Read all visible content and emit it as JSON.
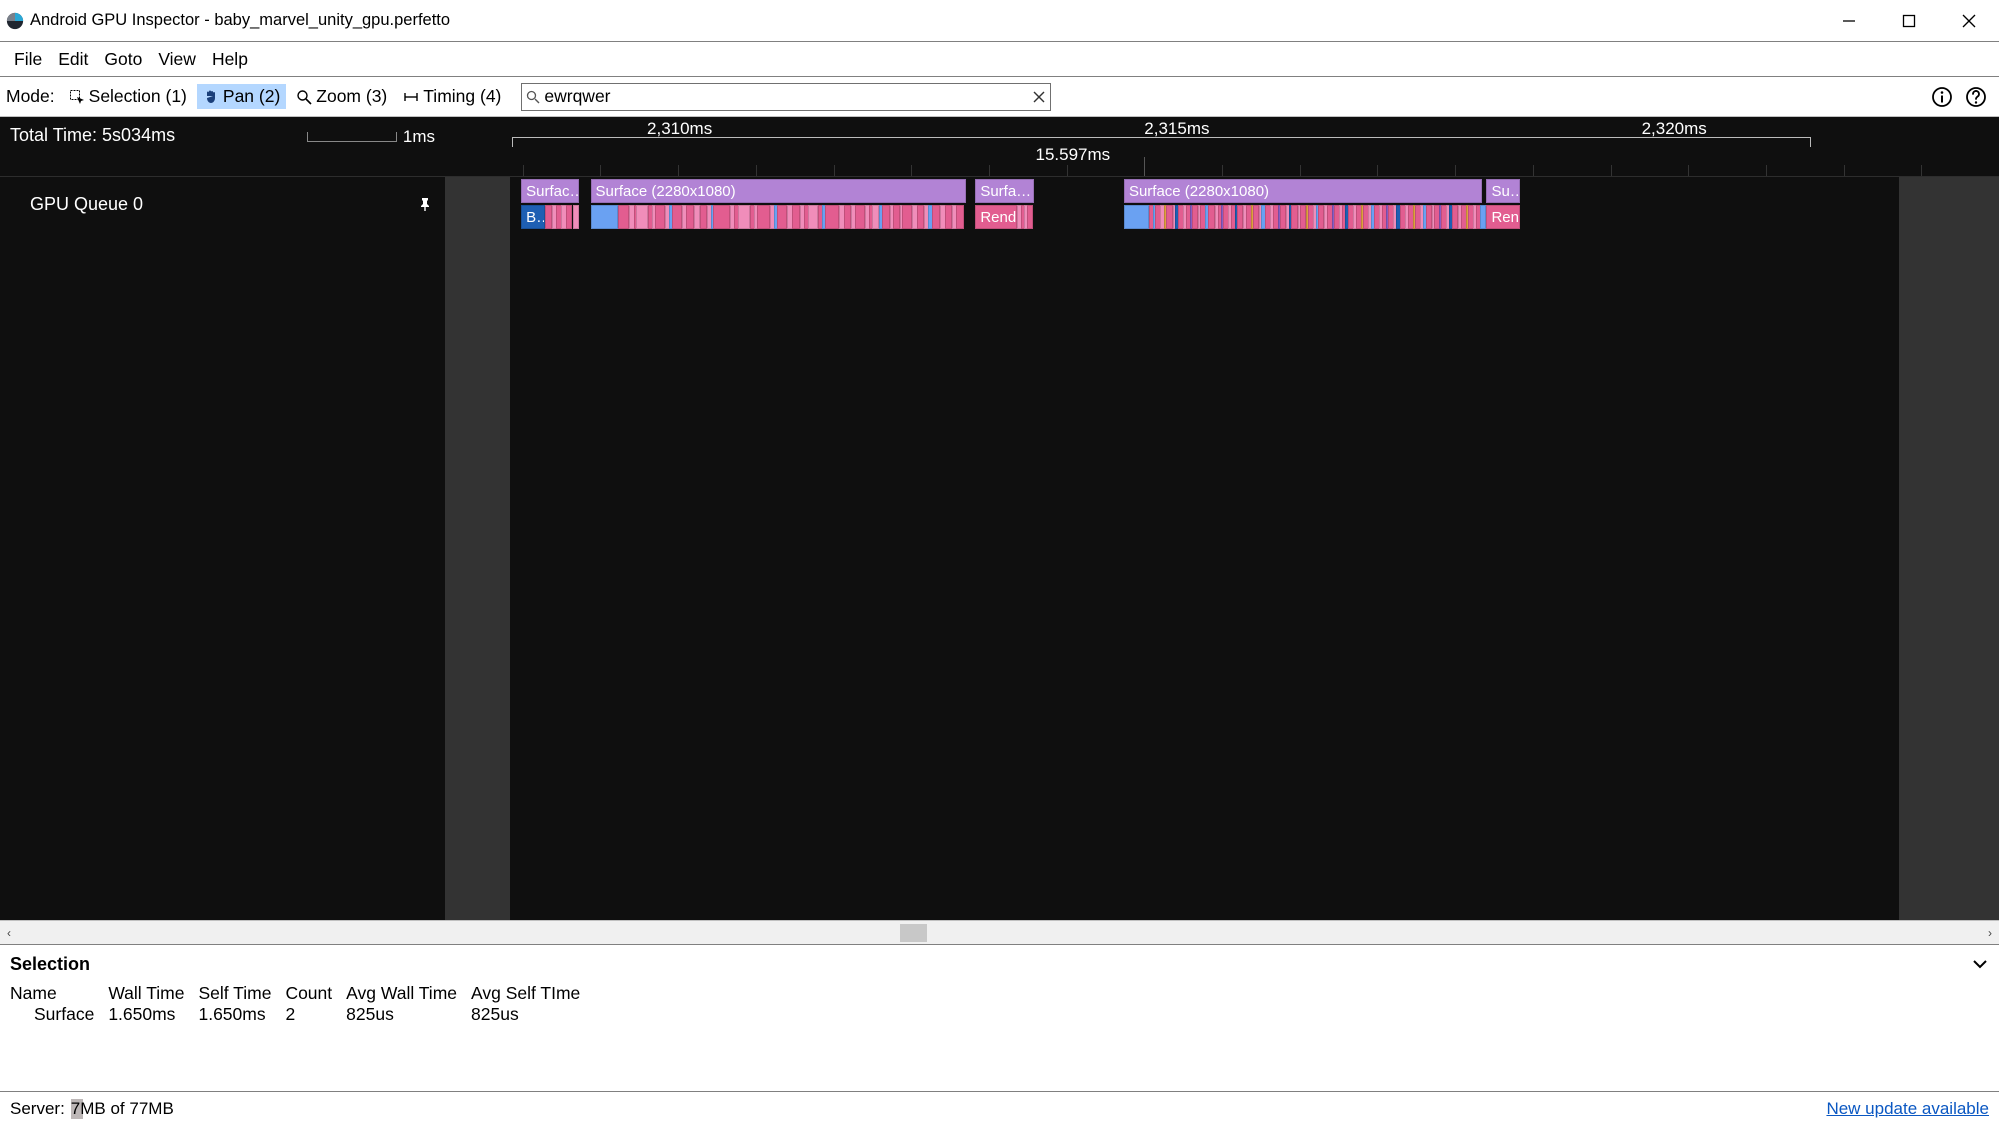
{
  "window": {
    "title": "Android GPU Inspector - baby_marvel_unity_gpu.perfetto"
  },
  "menubar": {
    "items": [
      "File",
      "Edit",
      "Goto",
      "View",
      "Help"
    ]
  },
  "toolbar": {
    "mode_label": "Mode:",
    "tools": {
      "selection": "Selection (1)",
      "pan": "Pan (2)",
      "zoom": "Zoom (3)",
      "timing": "Timing (4)"
    },
    "search_value": "ewrqwer"
  },
  "trace": {
    "total_time_label": "Total Time: 5s034ms",
    "scale_label": "1ms",
    "ruler_ticks": [
      "2,310ms",
      "2,315ms",
      "2,320ms"
    ],
    "range_label": "15.597ms",
    "track_name": "GPU Queue 0",
    "slices_row0": [
      {
        "label": "Surfac…",
        "l": 0.8,
        "w": 4.2,
        "cls": "purple"
      },
      {
        "label": "Surface (2280x1080)",
        "l": 5.8,
        "w": 27.0,
        "cls": "purple"
      },
      {
        "label": "Surfa…",
        "l": 33.5,
        "w": 4.2,
        "cls": "purple"
      },
      {
        "label": "Surface (2280x1080)",
        "l": 44.2,
        "w": 25.8,
        "cls": "purple"
      },
      {
        "label": "Su…",
        "l": 70.3,
        "w": 2.4,
        "cls": "purple"
      }
    ],
    "slices_row0_gaps": [
      {
        "l": 5.0,
        "w": 0.23
      },
      {
        "l": 5.25,
        "w": 0.18
      },
      {
        "l": 5.45,
        "w": 0.15
      },
      {
        "l": 37.9,
        "w": 0.12
      },
      {
        "l": 38.2,
        "w": 0.23
      },
      {
        "l": 38.5,
        "w": 0.14
      },
      {
        "l": 38.8,
        "w": 0.35
      },
      {
        "l": 39.2,
        "w": 0.1
      },
      {
        "l": 39.4,
        "w": 0.2
      },
      {
        "l": 39.7,
        "w": 0.18
      },
      {
        "l": 40.0,
        "w": 0.4
      },
      {
        "l": 40.6,
        "w": 0.12
      },
      {
        "l": 40.9,
        "w": 0.5
      },
      {
        "l": 41.6,
        "w": 0.1
      },
      {
        "l": 41.9,
        "w": 0.35
      },
      {
        "l": 42.4,
        "w": 0.1
      },
      {
        "l": 42.7,
        "w": 0.35
      },
      {
        "l": 43.2,
        "w": 0.18
      },
      {
        "l": 43.5,
        "w": 0.35
      },
      {
        "l": 43.9,
        "w": 0.1
      }
    ],
    "slices_row1": [
      {
        "label": "B…",
        "l": 0.8,
        "w": 1.7,
        "cls": "blue-dark"
      },
      {
        "label": "",
        "l": 2.5,
        "w": 0.5,
        "cls": "pink"
      },
      {
        "label": "",
        "l": 3.0,
        "w": 0.3,
        "cls": "pink-light"
      },
      {
        "label": "",
        "l": 3.3,
        "w": 0.4,
        "cls": "pink"
      },
      {
        "label": "",
        "l": 3.7,
        "w": 0.3,
        "cls": "pink-light"
      },
      {
        "label": "",
        "l": 4.0,
        "w": 0.5,
        "cls": "pink"
      },
      {
        "label": "",
        "l": 4.5,
        "w": 0.4,
        "cls": "pink-light"
      },
      {
        "label": "",
        "l": 5.8,
        "w": 2.0,
        "cls": "blue-mid"
      },
      {
        "label": "",
        "l": 7.8,
        "w": 0.8,
        "cls": "pink"
      },
      {
        "label": "",
        "l": 8.6,
        "w": 0.3,
        "cls": "pink-light"
      },
      {
        "label": "",
        "l": 8.9,
        "w": 0.2,
        "cls": "pink"
      },
      {
        "label": "",
        "l": 9.1,
        "w": 0.8,
        "cls": "pink-light"
      },
      {
        "label": "",
        "l": 9.9,
        "w": 0.3,
        "cls": "pink"
      },
      {
        "label": "",
        "l": 10.2,
        "w": 0.25,
        "cls": "pink-light"
      },
      {
        "label": "",
        "l": 10.45,
        "w": 0.7,
        "cls": "pink"
      },
      {
        "label": "",
        "l": 11.15,
        "w": 0.3,
        "cls": "pink-light"
      },
      {
        "label": "",
        "l": 11.45,
        "w": 0.2,
        "cls": "blue-mid"
      },
      {
        "label": "",
        "l": 11.65,
        "w": 0.7,
        "cls": "pink"
      },
      {
        "label": "",
        "l": 12.35,
        "w": 0.3,
        "cls": "pink-light"
      },
      {
        "label": "",
        "l": 12.65,
        "w": 0.6,
        "cls": "pink"
      },
      {
        "label": "",
        "l": 13.25,
        "w": 0.4,
        "cls": "pink-light"
      },
      {
        "label": "",
        "l": 13.65,
        "w": 0.5,
        "cls": "pink"
      },
      {
        "label": "",
        "l": 14.15,
        "w": 0.3,
        "cls": "pink-light"
      },
      {
        "label": "",
        "l": 14.45,
        "w": 0.2,
        "cls": "blue-mid"
      },
      {
        "label": "",
        "l": 14.65,
        "w": 1.2,
        "cls": "pink"
      },
      {
        "label": "",
        "l": 15.85,
        "w": 0.3,
        "cls": "pink-light"
      },
      {
        "label": "",
        "l": 16.15,
        "w": 0.25,
        "cls": "pink"
      },
      {
        "label": "",
        "l": 16.4,
        "w": 0.9,
        "cls": "pink-light"
      },
      {
        "label": "",
        "l": 17.3,
        "w": 0.3,
        "cls": "pink"
      },
      {
        "label": "",
        "l": 17.6,
        "w": 0.2,
        "cls": "pink-light"
      },
      {
        "label": "",
        "l": 17.8,
        "w": 0.9,
        "cls": "pink"
      },
      {
        "label": "",
        "l": 18.7,
        "w": 0.3,
        "cls": "pink-light"
      },
      {
        "label": "",
        "l": 19.0,
        "w": 0.25,
        "cls": "blue-mid"
      },
      {
        "label": "",
        "l": 19.25,
        "w": 0.7,
        "cls": "pink"
      },
      {
        "label": "",
        "l": 19.95,
        "w": 0.35,
        "cls": "pink-light"
      },
      {
        "label": "",
        "l": 20.3,
        "w": 0.6,
        "cls": "pink"
      },
      {
        "label": "",
        "l": 20.9,
        "w": 0.3,
        "cls": "pink-light"
      },
      {
        "label": "",
        "l": 21.2,
        "w": 0.25,
        "cls": "pink"
      },
      {
        "label": "",
        "l": 21.45,
        "w": 0.7,
        "cls": "pink-light"
      },
      {
        "label": "",
        "l": 22.15,
        "w": 0.3,
        "cls": "pink"
      },
      {
        "label": "",
        "l": 22.45,
        "w": 0.25,
        "cls": "blue-mid"
      },
      {
        "label": "",
        "l": 22.7,
        "w": 1.0,
        "cls": "pink"
      },
      {
        "label": "",
        "l": 23.7,
        "w": 0.35,
        "cls": "pink-light"
      },
      {
        "label": "",
        "l": 24.05,
        "w": 0.5,
        "cls": "pink"
      },
      {
        "label": "",
        "l": 24.55,
        "w": 0.3,
        "cls": "pink-light"
      },
      {
        "label": "",
        "l": 24.85,
        "w": 0.7,
        "cls": "pink"
      },
      {
        "label": "",
        "l": 25.55,
        "w": 0.3,
        "cls": "pink-light"
      },
      {
        "label": "",
        "l": 25.85,
        "w": 0.2,
        "cls": "pink"
      },
      {
        "label": "",
        "l": 26.05,
        "w": 0.5,
        "cls": "pink-light"
      },
      {
        "label": "",
        "l": 26.55,
        "w": 0.2,
        "cls": "blue-mid"
      },
      {
        "label": "",
        "l": 26.75,
        "w": 0.6,
        "cls": "pink"
      },
      {
        "label": "",
        "l": 27.35,
        "w": 0.2,
        "cls": "pink-light"
      },
      {
        "label": "",
        "l": 27.55,
        "w": 0.5,
        "cls": "pink"
      },
      {
        "label": "",
        "l": 28.05,
        "w": 0.2,
        "cls": "pink-light"
      },
      {
        "label": "",
        "l": 28.25,
        "w": 0.7,
        "cls": "pink"
      },
      {
        "label": "",
        "l": 28.95,
        "w": 0.35,
        "cls": "pink-light"
      },
      {
        "label": "",
        "l": 29.3,
        "w": 0.5,
        "cls": "pink"
      },
      {
        "label": "",
        "l": 29.8,
        "w": 0.3,
        "cls": "pink-light"
      },
      {
        "label": "",
        "l": 30.1,
        "w": 0.25,
        "cls": "blue-mid"
      },
      {
        "label": "",
        "l": 30.35,
        "w": 0.6,
        "cls": "pink"
      },
      {
        "label": "",
        "l": 30.95,
        "w": 0.35,
        "cls": "pink-light"
      },
      {
        "label": "",
        "l": 31.3,
        "w": 0.5,
        "cls": "pink"
      },
      {
        "label": "",
        "l": 31.8,
        "w": 0.3,
        "cls": "pink-light"
      },
      {
        "label": "",
        "l": 32.1,
        "w": 0.6,
        "cls": "pink"
      },
      {
        "label": "Render",
        "l": 33.5,
        "w": 3.0,
        "cls": "pink"
      },
      {
        "label": "",
        "l": 36.5,
        "w": 0.3,
        "cls": "pink-light"
      },
      {
        "label": "",
        "l": 36.8,
        "w": 0.2,
        "cls": "pink"
      },
      {
        "label": "",
        "l": 37.0,
        "w": 0.2,
        "cls": "pink-light"
      },
      {
        "label": "",
        "l": 37.2,
        "w": 0.3,
        "cls": "pink"
      },
      {
        "label": "",
        "l": 44.2,
        "w": 1.8,
        "cls": "blue-mid"
      },
      {
        "label": "",
        "l": 46.0,
        "w": 0.3,
        "cls": "pink"
      },
      {
        "label": "",
        "l": 46.3,
        "w": 0.15,
        "cls": "blue-mid"
      },
      {
        "label": "",
        "l": 46.45,
        "w": 0.35,
        "cls": "pink"
      },
      {
        "label": "",
        "l": 46.8,
        "w": 0.25,
        "cls": "pink-light"
      },
      {
        "label": "",
        "l": 47.05,
        "w": 0.15,
        "cls": "orange"
      },
      {
        "label": "",
        "l": 47.2,
        "w": 0.5,
        "cls": "pink"
      },
      {
        "label": "",
        "l": 47.7,
        "w": 0.2,
        "cls": "pink-light"
      },
      {
        "label": "",
        "l": 47.9,
        "w": 0.2,
        "cls": "blue-dark"
      },
      {
        "label": "",
        "l": 48.1,
        "w": 0.35,
        "cls": "pink"
      },
      {
        "label": "",
        "l": 48.45,
        "w": 0.2,
        "cls": "pink-light"
      },
      {
        "label": "",
        "l": 48.65,
        "w": 0.3,
        "cls": "pink"
      },
      {
        "label": "",
        "l": 48.95,
        "w": 0.15,
        "cls": "purple-d"
      },
      {
        "label": "",
        "l": 49.1,
        "w": 0.4,
        "cls": "pink"
      },
      {
        "label": "",
        "l": 49.5,
        "w": 0.2,
        "cls": "pink-light"
      },
      {
        "label": "",
        "l": 49.7,
        "w": 0.35,
        "cls": "pink"
      },
      {
        "label": "",
        "l": 50.05,
        "w": 0.2,
        "cls": "blue-mid"
      },
      {
        "label": "",
        "l": 50.25,
        "w": 0.5,
        "cls": "pink"
      },
      {
        "label": "",
        "l": 50.75,
        "w": 0.2,
        "cls": "pink-light"
      },
      {
        "label": "",
        "l": 50.95,
        "w": 0.25,
        "cls": "pink"
      },
      {
        "label": "",
        "l": 51.2,
        "w": 0.15,
        "cls": "purple-d"
      },
      {
        "label": "",
        "l": 51.35,
        "w": 0.35,
        "cls": "pink"
      },
      {
        "label": "",
        "l": 51.7,
        "w": 0.2,
        "cls": "pink-light"
      },
      {
        "label": "",
        "l": 51.9,
        "w": 0.3,
        "cls": "pink"
      },
      {
        "label": "",
        "l": 52.2,
        "w": 0.15,
        "cls": "blue-dark"
      },
      {
        "label": "",
        "l": 52.35,
        "w": 0.45,
        "cls": "pink"
      },
      {
        "label": "",
        "l": 52.8,
        "w": 0.2,
        "cls": "pink-light"
      },
      {
        "label": "",
        "l": 53.0,
        "w": 0.35,
        "cls": "pink"
      },
      {
        "label": "",
        "l": 53.35,
        "w": 0.15,
        "cls": "orange"
      },
      {
        "label": "",
        "l": 53.5,
        "w": 0.4,
        "cls": "pink"
      },
      {
        "label": "",
        "l": 53.9,
        "w": 0.2,
        "cls": "pink-light"
      },
      {
        "label": "",
        "l": 54.1,
        "w": 0.25,
        "cls": "blue-mid"
      },
      {
        "label": "",
        "l": 54.35,
        "w": 0.4,
        "cls": "pink"
      },
      {
        "label": "",
        "l": 54.75,
        "w": 0.2,
        "cls": "pink-light"
      },
      {
        "label": "",
        "l": 54.95,
        "w": 0.35,
        "cls": "pink"
      },
      {
        "label": "",
        "l": 55.3,
        "w": 0.15,
        "cls": "purple-d"
      },
      {
        "label": "",
        "l": 55.45,
        "w": 0.4,
        "cls": "pink"
      },
      {
        "label": "",
        "l": 55.85,
        "w": 0.2,
        "cls": "pink-light"
      },
      {
        "label": "",
        "l": 56.05,
        "w": 0.2,
        "cls": "blue-dark"
      },
      {
        "label": "",
        "l": 56.25,
        "w": 0.45,
        "cls": "pink"
      },
      {
        "label": "",
        "l": 56.7,
        "w": 0.2,
        "cls": "pink-light"
      },
      {
        "label": "",
        "l": 56.9,
        "w": 0.4,
        "cls": "pink"
      },
      {
        "label": "",
        "l": 57.3,
        "w": 0.15,
        "cls": "orange"
      },
      {
        "label": "",
        "l": 57.45,
        "w": 0.35,
        "cls": "pink"
      },
      {
        "label": "",
        "l": 57.8,
        "w": 0.2,
        "cls": "pink-light"
      },
      {
        "label": "",
        "l": 58.0,
        "w": 0.2,
        "cls": "blue-mid"
      },
      {
        "label": "",
        "l": 58.2,
        "w": 0.4,
        "cls": "pink"
      },
      {
        "label": "",
        "l": 58.6,
        "w": 0.2,
        "cls": "pink-light"
      },
      {
        "label": "",
        "l": 58.8,
        "w": 0.35,
        "cls": "pink"
      },
      {
        "label": "",
        "l": 59.15,
        "w": 0.15,
        "cls": "purple-d"
      },
      {
        "label": "",
        "l": 59.3,
        "w": 0.4,
        "cls": "pink"
      },
      {
        "label": "",
        "l": 59.7,
        "w": 0.2,
        "cls": "pink-light"
      },
      {
        "label": "",
        "l": 59.9,
        "w": 0.25,
        "cls": "pink"
      },
      {
        "label": "",
        "l": 60.15,
        "w": 0.15,
        "cls": "blue-dark"
      },
      {
        "label": "",
        "l": 60.3,
        "w": 0.4,
        "cls": "pink"
      },
      {
        "label": "",
        "l": 60.7,
        "w": 0.2,
        "cls": "pink-light"
      },
      {
        "label": "",
        "l": 60.9,
        "w": 0.35,
        "cls": "pink"
      },
      {
        "label": "",
        "l": 61.25,
        "w": 0.15,
        "cls": "orange"
      },
      {
        "label": "",
        "l": 61.4,
        "w": 0.4,
        "cls": "pink"
      },
      {
        "label": "",
        "l": 61.8,
        "w": 0.2,
        "cls": "pink-light"
      },
      {
        "label": "",
        "l": 62.0,
        "w": 0.2,
        "cls": "blue-mid"
      },
      {
        "label": "",
        "l": 62.2,
        "w": 0.35,
        "cls": "pink"
      },
      {
        "label": "",
        "l": 62.55,
        "w": 0.2,
        "cls": "pink-light"
      },
      {
        "label": "",
        "l": 62.75,
        "w": 0.3,
        "cls": "pink"
      },
      {
        "label": "",
        "l": 63.05,
        "w": 0.15,
        "cls": "purple-d"
      },
      {
        "label": "",
        "l": 63.2,
        "w": 0.4,
        "cls": "pink"
      },
      {
        "label": "",
        "l": 63.6,
        "w": 0.2,
        "cls": "pink-light"
      },
      {
        "label": "",
        "l": 63.8,
        "w": 0.25,
        "cls": "blue-dark"
      },
      {
        "label": "",
        "l": 64.05,
        "w": 0.4,
        "cls": "pink"
      },
      {
        "label": "",
        "l": 64.45,
        "w": 0.2,
        "cls": "pink-light"
      },
      {
        "label": "",
        "l": 64.65,
        "w": 0.35,
        "cls": "pink"
      },
      {
        "label": "",
        "l": 65.0,
        "w": 0.15,
        "cls": "orange"
      },
      {
        "label": "",
        "l": 65.15,
        "w": 0.4,
        "cls": "pink"
      },
      {
        "label": "",
        "l": 65.55,
        "w": 0.2,
        "cls": "pink-light"
      },
      {
        "label": "",
        "l": 65.75,
        "w": 0.2,
        "cls": "blue-mid"
      },
      {
        "label": "",
        "l": 65.95,
        "w": 0.4,
        "cls": "pink"
      },
      {
        "label": "",
        "l": 66.35,
        "w": 0.2,
        "cls": "pink-light"
      },
      {
        "label": "",
        "l": 66.55,
        "w": 0.3,
        "cls": "pink"
      },
      {
        "label": "",
        "l": 66.85,
        "w": 0.15,
        "cls": "purple-d"
      },
      {
        "label": "",
        "l": 67.0,
        "w": 0.4,
        "cls": "pink"
      },
      {
        "label": "",
        "l": 67.4,
        "w": 0.2,
        "cls": "pink-light"
      },
      {
        "label": "",
        "l": 67.6,
        "w": 0.25,
        "cls": "blue-dark"
      },
      {
        "label": "",
        "l": 67.85,
        "w": 0.4,
        "cls": "pink"
      },
      {
        "label": "",
        "l": 68.25,
        "w": 0.2,
        "cls": "pink-light"
      },
      {
        "label": "",
        "l": 68.45,
        "w": 0.35,
        "cls": "pink"
      },
      {
        "label": "",
        "l": 68.8,
        "w": 0.15,
        "cls": "orange"
      },
      {
        "label": "",
        "l": 68.95,
        "w": 0.4,
        "cls": "pink"
      },
      {
        "label": "",
        "l": 69.35,
        "w": 0.2,
        "cls": "pink-light"
      },
      {
        "label": "",
        "l": 69.55,
        "w": 0.3,
        "cls": "pink"
      },
      {
        "label": "",
        "l": 69.85,
        "w": 0.15,
        "cls": "blue-mid"
      },
      {
        "label": "Ren…",
        "l": 70.3,
        "w": 2.4,
        "cls": "pink"
      }
    ]
  },
  "selection": {
    "title": "Selection",
    "columns": [
      "Name",
      "Wall Time",
      "Self Time",
      "Count",
      "Avg Wall Time",
      "Avg Self TIme"
    ],
    "row": [
      "Surface",
      "1.650ms",
      "1.650ms",
      "2",
      "825us",
      "825us"
    ]
  },
  "status": {
    "server_label": "Server:",
    "memory": "7MB of 77MB",
    "update_link": "New update available"
  }
}
